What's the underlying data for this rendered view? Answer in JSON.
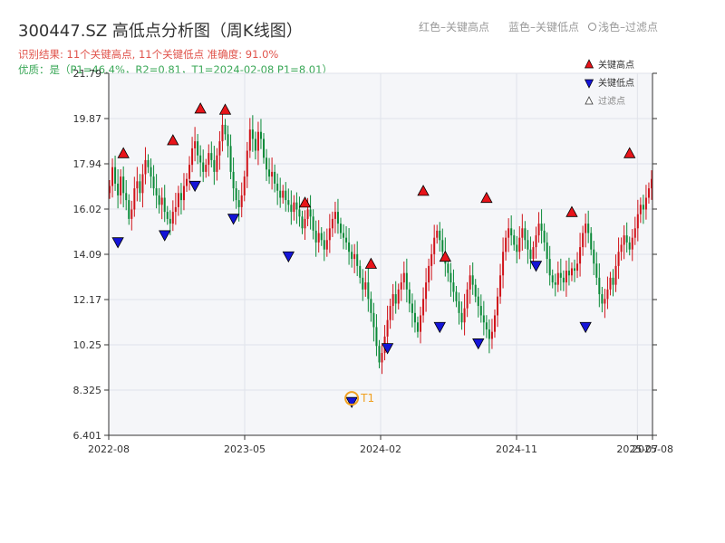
{
  "title": "300447.SZ 高低点分析图（周K线图）",
  "subtitle": "识别结果: 11个关键高点, 11个关键低点   准确度: 91.0%",
  "quality": "优质：是（P1=46.4%，R2=0.81，T1=2024-02-08 P1=8.01）",
  "top_legend": {
    "red": "红色–关键高点",
    "blue": "蓝色–关键低点",
    "light": "浅色–过滤点"
  },
  "colors": {
    "up": "#d0131a",
    "down": "#0b8a38",
    "high_marker": "#e8141a",
    "low_marker": "#1414d8",
    "t1_marker": "#f0a020",
    "plot_bg": "#f5f6f9",
    "grid": "#e0e3ea"
  },
  "chart_data": {
    "type": "candlestick",
    "title": "300447.SZ 高低点分析图（周K线图）",
    "x_axis": {
      "tick_labels": [
        "2022-08",
        "2023-05",
        "2024-02",
        "2024-11",
        "2025-07",
        "2025-08"
      ],
      "tick_positions": [
        "2022-08",
        "2023-05",
        "2024-02",
        "2024-11",
        "2025-07",
        "2025-08"
      ],
      "range": [
        "2022-08",
        "2025-08"
      ]
    },
    "y_axis": {
      "tick_labels": [
        "6.401",
        "8.325",
        "10.25",
        "12.17",
        "14.09",
        "16.02",
        "17.94",
        "19.87",
        "21.79"
      ],
      "ylim": [
        6.401,
        21.79
      ]
    },
    "grid": true,
    "legend": {
      "placement": "top-right",
      "items": [
        {
          "name": "关键高点",
          "marker": "high"
        },
        {
          "name": "关键低点",
          "marker": "low"
        },
        {
          "name": "过滤点",
          "marker": "filtered"
        }
      ]
    },
    "series_close": [
      17.0,
      17.8,
      17.1,
      16.6,
      17.4,
      16.7,
      16.4,
      15.6,
      16.0,
      16.9,
      17.2,
      16.7,
      17.5,
      18.1,
      17.8,
      17.4,
      16.9,
      16.6,
      16.2,
      16.5,
      15.9,
      15.6,
      15.4,
      15.9,
      16.1,
      16.7,
      16.4,
      17.0,
      17.3,
      17.9,
      18.6,
      18.9,
      18.3,
      18.0,
      17.6,
      17.9,
      18.4,
      18.1,
      17.6,
      18.3,
      18.9,
      19.6,
      19.2,
      18.7,
      17.6,
      16.9,
      16.4,
      16.1,
      16.6,
      17.4,
      18.5,
      19.4,
      19.0,
      18.5,
      19.3,
      19.0,
      18.2,
      17.7,
      17.4,
      17.6,
      17.1,
      16.8,
      16.5,
      16.8,
      16.4,
      16.2,
      15.9,
      16.3,
      16.0,
      15.7,
      15.2,
      15.6,
      16.0,
      15.7,
      15.1,
      14.6,
      15.0,
      14.7,
      14.3,
      14.7,
      15.2,
      15.6,
      15.9,
      15.4,
      15.0,
      14.8,
      14.6,
      14.2,
      13.9,
      14.1,
      13.6,
      13.1,
      12.6,
      12.9,
      12.2,
      11.6,
      11.0,
      10.2,
      9.5,
      9.9,
      10.6,
      11.3,
      11.9,
      12.4,
      12.0,
      12.6,
      12.9,
      13.3,
      12.6,
      12.0,
      11.6,
      11.2,
      10.8,
      11.5,
      12.2,
      12.9,
      13.6,
      14.1,
      14.8,
      15.1,
      14.7,
      14.2,
      13.7,
      13.3,
      12.9,
      12.5,
      12.1,
      11.6,
      11.2,
      11.8,
      12.6,
      13.2,
      12.8,
      12.3,
      11.9,
      11.5,
      11.2,
      10.9,
      10.5,
      10.8,
      11.5,
      12.3,
      13.2,
      14.2,
      14.8,
      15.2,
      14.9,
      14.5,
      14.2,
      14.8,
      15.2,
      14.7,
      14.3,
      13.9,
      14.4,
      14.9,
      15.4,
      15.1,
      14.6,
      13.9,
      13.2,
      12.9,
      12.8,
      13.3,
      13.1,
      12.9,
      13.4,
      13.2,
      13.5,
      13.4,
      13.7,
      14.4,
      15.0,
      15.4,
      15.0,
      14.3,
      13.7,
      13.1,
      12.4,
      12.0,
      12.2,
      12.6,
      13.1,
      12.8,
      13.6,
      14.2,
      14.5,
      14.9,
      14.6,
      14.3,
      14.8,
      15.2,
      15.8,
      16.2,
      16.0,
      16.5,
      16.9,
      17.3
    ],
    "key_highs": [
      {
        "idx": 5,
        "value": 18.2
      },
      {
        "idx": 23,
        "value": 18.75
      },
      {
        "idx": 33,
        "value": 20.1
      },
      {
        "idx": 42,
        "value": 20.05
      },
      {
        "idx": 71,
        "value": 16.1
      },
      {
        "idx": 95,
        "value": 13.5
      },
      {
        "idx": 114,
        "value": 16.6
      },
      {
        "idx": 122,
        "value": 13.8
      },
      {
        "idx": 137,
        "value": 16.3
      },
      {
        "idx": 168,
        "value": 15.7
      },
      {
        "idx": 189,
        "value": 18.2
      }
    ],
    "key_lows": [
      {
        "idx": 3,
        "value": 14.8
      },
      {
        "idx": 20,
        "value": 15.1
      },
      {
        "idx": 31,
        "value": 17.2
      },
      {
        "idx": 45,
        "value": 15.8
      },
      {
        "idx": 65,
        "value": 14.2
      },
      {
        "idx": 101,
        "value": 10.3
      },
      {
        "idx": 120,
        "value": 11.2
      },
      {
        "idx": 134,
        "value": 10.5
      },
      {
        "idx": 155,
        "value": 13.8
      },
      {
        "idx": 173,
        "value": 11.2
      },
      {
        "idx": 88,
        "value": 8.01
      }
    ],
    "t1": {
      "label": "T1",
      "date": "2024-02-08",
      "value": 8.01,
      "idx": 88
    }
  }
}
